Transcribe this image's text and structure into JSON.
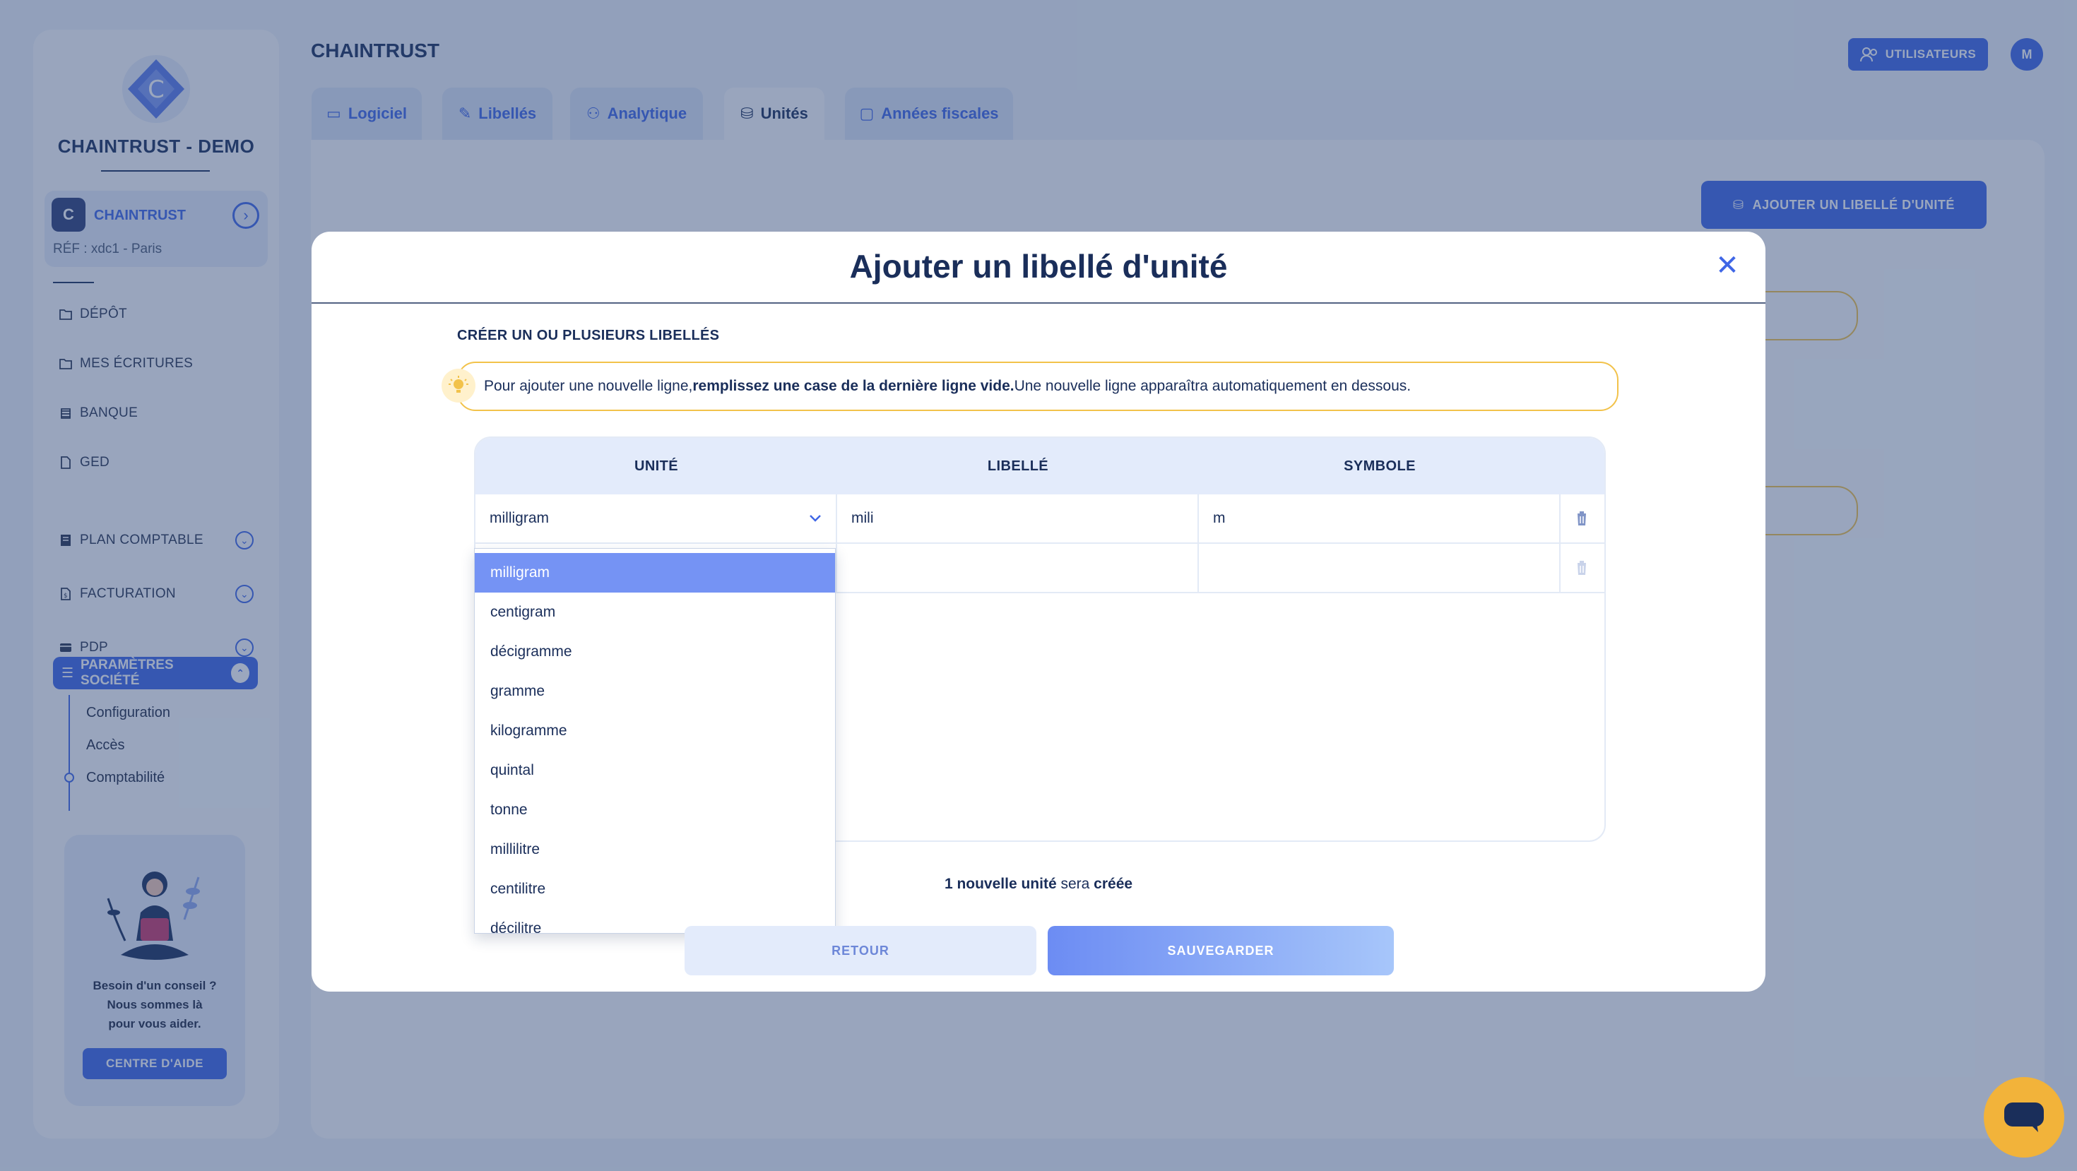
{
  "sidebar": {
    "company": "CHAINTRUST - DEMO",
    "org": {
      "avatar_letter": "C",
      "name": "CHAINTRUST",
      "ref": "RÉF : xdc1 - Paris"
    },
    "nav": [
      {
        "label": "DÉPÔT",
        "icon": "folder-icon"
      },
      {
        "label": "MES ÉCRITURES",
        "icon": "folder-icon"
      },
      {
        "label": "BANQUE",
        "icon": "bank-icon"
      },
      {
        "label": "GED",
        "icon": "document-icon"
      },
      {
        "label": "PLAN COMPTABLE",
        "icon": "book-icon"
      },
      {
        "label": "FACTURATION",
        "icon": "invoice-icon"
      },
      {
        "label": "PDP",
        "icon": "card-icon"
      }
    ],
    "params_label": "PARAMÈTRES SOCIÉTÉ",
    "sub_items": [
      "Configuration",
      "Accès",
      "Comptabilité"
    ],
    "help": {
      "line1": "Besoin d'un conseil ?",
      "line2": "Nous sommes là",
      "line3": "pour vous aider.",
      "button": "CENTRE D'AIDE"
    }
  },
  "header": {
    "title": "CHAINTRUST",
    "users_button": "UTILISATEURS",
    "avatar": "M"
  },
  "tabs": [
    {
      "label": "Logiciel"
    },
    {
      "label": "Libellés"
    },
    {
      "label": "Analytique"
    },
    {
      "label": "Unités"
    },
    {
      "label": "Années fiscales"
    }
  ],
  "panel": {
    "add_button": "AJOUTER UN LIBELLÉ D'UNITÉ"
  },
  "modal": {
    "title": "Ajouter un libellé d'unité",
    "section": "CRÉER UN OU PLUSIEURS LIBELLÉS",
    "tip_pre": "Pour ajouter une nouvelle ligne, ",
    "tip_bold": "remplissez une case de la dernière ligne vide.",
    "tip_post": " Une nouvelle ligne apparaîtra automatiquement en dessous.",
    "columns": [
      "UNITÉ",
      "LIBELLÉ",
      "SYMBOLE"
    ],
    "rows": [
      {
        "unit": "milligram",
        "label": "mili",
        "symbol": "m"
      },
      {
        "unit": "",
        "label": "",
        "symbol": ""
      }
    ],
    "dropdown_options": [
      "milligram",
      "centigram",
      "décigramme",
      "gramme",
      "kilogramme",
      "quintal",
      "tonne",
      "millilitre",
      "centilitre",
      "décilitre"
    ],
    "selected_option": "milligram",
    "count_num": "1 nouvelle unité",
    "count_mid": " sera ",
    "count_end": "créée",
    "back_button": "RETOUR",
    "save_button": "SAUVEGARDER"
  },
  "colors": {
    "accent": "#3f66e6",
    "navy": "#1a2e5a",
    "warning_border": "#f2c24a",
    "chat": "#f2b33a"
  }
}
